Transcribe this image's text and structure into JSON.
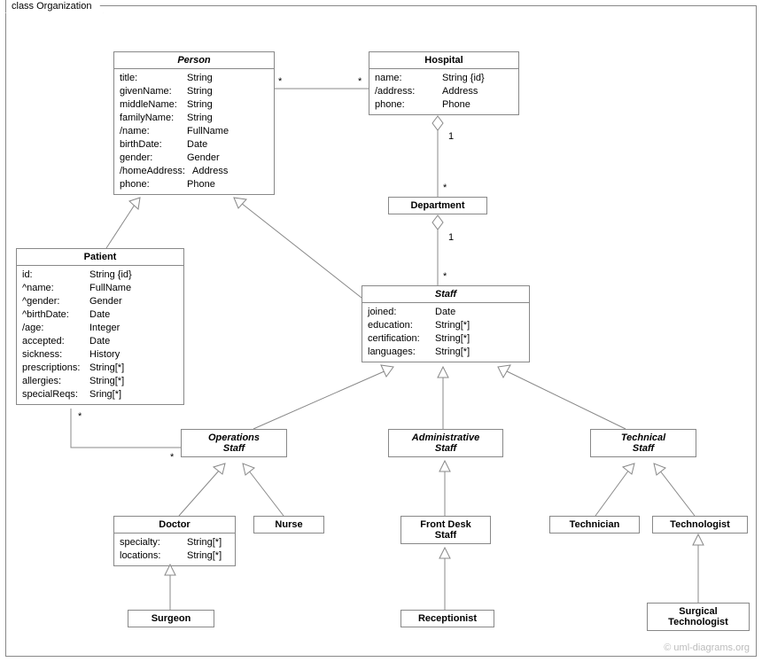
{
  "frame": {
    "title": "class Organization"
  },
  "watermark": "© uml-diagrams.org",
  "classes": {
    "person": {
      "name": "Person",
      "attrs": [
        {
          "n": "title:",
          "t": "String"
        },
        {
          "n": "givenName:",
          "t": "String"
        },
        {
          "n": "middleName:",
          "t": "String"
        },
        {
          "n": "familyName:",
          "t": "String"
        },
        {
          "n": "/name:",
          "t": "FullName"
        },
        {
          "n": "birthDate:",
          "t": "Date"
        },
        {
          "n": "gender:",
          "t": "Gender"
        },
        {
          "n": "/homeAddress:",
          "t": "Address"
        },
        {
          "n": "phone:",
          "t": "Phone"
        }
      ]
    },
    "hospital": {
      "name": "Hospital",
      "attrs": [
        {
          "n": "name:",
          "t": "String {id}"
        },
        {
          "n": "/address:",
          "t": "Address"
        },
        {
          "n": "phone:",
          "t": "Phone"
        }
      ]
    },
    "department": {
      "name": "Department"
    },
    "patient": {
      "name": "Patient",
      "attrs": [
        {
          "n": "id:",
          "t": "String {id}"
        },
        {
          "n": "^name:",
          "t": "FullName"
        },
        {
          "n": "^gender:",
          "t": "Gender"
        },
        {
          "n": "^birthDate:",
          "t": "Date"
        },
        {
          "n": "/age:",
          "t": "Integer"
        },
        {
          "n": "accepted:",
          "t": "Date"
        },
        {
          "n": "sickness:",
          "t": "History"
        },
        {
          "n": "prescriptions:",
          "t": "String[*]"
        },
        {
          "n": "allergies:",
          "t": "String[*]"
        },
        {
          "n": "specialReqs:",
          "t": "Sring[*]"
        }
      ]
    },
    "staff": {
      "name": "Staff",
      "attrs": [
        {
          "n": "joined:",
          "t": "Date"
        },
        {
          "n": "education:",
          "t": "String[*]"
        },
        {
          "n": "certification:",
          "t": "String[*]"
        },
        {
          "n": "languages:",
          "t": "String[*]"
        }
      ]
    },
    "opsStaff": {
      "name": "Operations\nStaff"
    },
    "adminStaff": {
      "name": "Administrative\nStaff"
    },
    "techStaff": {
      "name": "Technical\nStaff"
    },
    "doctor": {
      "name": "Doctor",
      "attrs": [
        {
          "n": "specialty:",
          "t": "String[*]"
        },
        {
          "n": "locations:",
          "t": "String[*]"
        }
      ]
    },
    "nurse": {
      "name": "Nurse"
    },
    "frontDesk": {
      "name": "Front Desk\nStaff"
    },
    "technician": {
      "name": "Technician"
    },
    "technologist": {
      "name": "Technologist"
    },
    "surgeon": {
      "name": "Surgeon"
    },
    "receptionist": {
      "name": "Receptionist"
    },
    "surgTech": {
      "name": "Surgical\nTechnologist"
    }
  },
  "mults": {
    "personHosp_p": "*",
    "personHosp_h": "*",
    "hospDept_h": "1",
    "hospDept_d": "*",
    "deptStaff_d": "1",
    "deptStaff_s": "*",
    "patientOps_p": "*",
    "patientOps_o": "*"
  }
}
